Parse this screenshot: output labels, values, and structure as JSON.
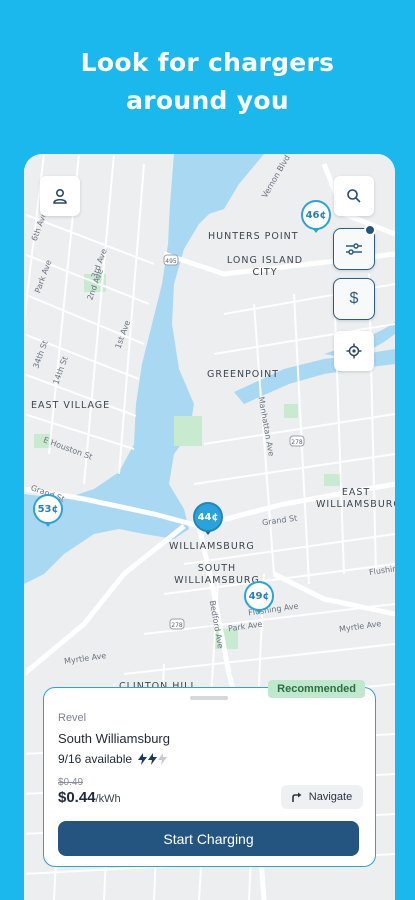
{
  "headline": {
    "line1": "Look for chargers",
    "line2": "around you"
  },
  "map": {
    "neighborhoods": [
      {
        "label": "HUNTERS POINT"
      },
      {
        "label": "LONG ISLAND CITY"
      },
      {
        "label": "GREENPOINT"
      },
      {
        "label": "EAST VILLAGE"
      },
      {
        "label": "WILLIAMSBURG"
      },
      {
        "label": "SOUTH WILLIAMSBURG"
      },
      {
        "label": "EAST WILLIAMSBURG"
      },
      {
        "label": "CLINTON HILL"
      }
    ],
    "streets": [
      {
        "label": "Vernon Blvd"
      },
      {
        "label": "6th Ave"
      },
      {
        "label": "Park Ave"
      },
      {
        "label": "2nd Ave"
      },
      {
        "label": "3rd Ave"
      },
      {
        "label": "34th St"
      },
      {
        "label": "14th St"
      },
      {
        "label": "1st Ave"
      },
      {
        "label": "E Houston St"
      },
      {
        "label": "Grand St"
      },
      {
        "label": "Manhattan Ave"
      },
      {
        "label": "Grand St"
      },
      {
        "label": "Flushing Ave"
      },
      {
        "label": "Bedford Ave"
      },
      {
        "label": "Park Ave"
      },
      {
        "label": "Myrtle Ave"
      },
      {
        "label": "Myrtle Ave"
      },
      {
        "label": "Flushin"
      }
    ],
    "highway_shields": [
      "495",
      "278",
      "278"
    ],
    "pins": [
      {
        "price": "46¢"
      },
      {
        "price": "44¢"
      },
      {
        "price": "53¢"
      },
      {
        "price": "49¢"
      }
    ]
  },
  "controls": {
    "profile_icon": "person-icon",
    "search_icon": "search-icon",
    "filter_icon": "sliders-icon",
    "price_symbol": "$",
    "locate_icon": "crosshair-icon"
  },
  "station_card": {
    "badge": "Recommended",
    "provider": "Revel",
    "name": "South Williamsburg",
    "availability": "9/16 available",
    "old_price": "$0.49",
    "price": "$0.44",
    "price_unit": "/kWh",
    "navigate_label": "Navigate",
    "cta_label": "Start Charging"
  },
  "colors": {
    "background": "#1bb8ee",
    "accent": "#2aa3dc",
    "primary": "#235580",
    "badge_bg": "#bfe8cc",
    "water": "#a9d8f2",
    "park": "#c8ebd0"
  }
}
